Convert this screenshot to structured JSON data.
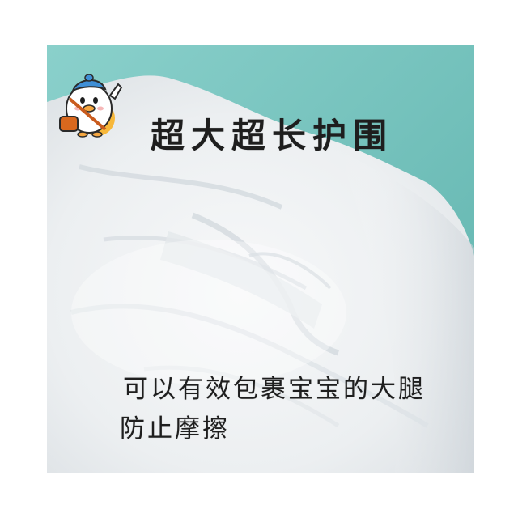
{
  "title": "超大超长护围",
  "body_line_1": "可以有效包裹宝宝的大腿",
  "body_line_2": "防止摩擦",
  "colors": {
    "background": "#ffffff",
    "teal_backdrop": "#7fc8c3",
    "diaper_white": "#f3f5f6",
    "text": "#1e1e1e"
  }
}
